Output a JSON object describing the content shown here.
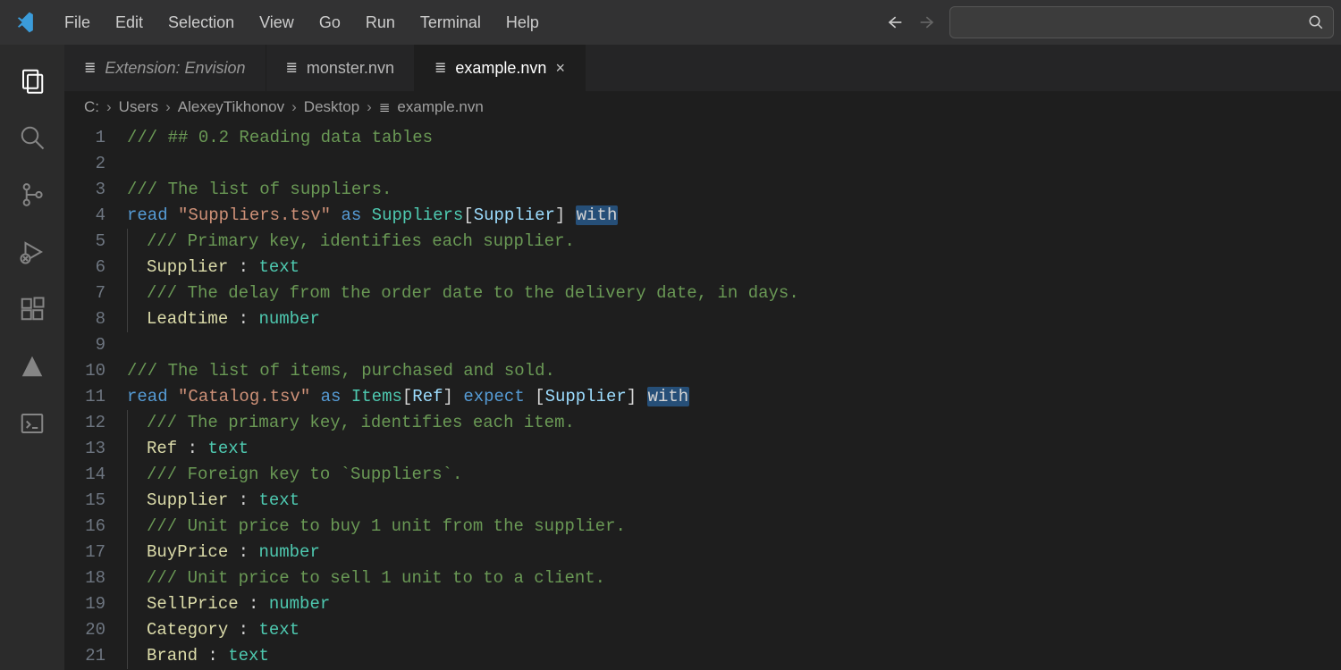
{
  "menubar": {
    "items": [
      "File",
      "Edit",
      "Selection",
      "View",
      "Go",
      "Run",
      "Terminal",
      "Help"
    ]
  },
  "tabs": [
    {
      "label": "Extension: Envision",
      "active": false,
      "italic": true,
      "closable": false
    },
    {
      "label": "monster.nvn",
      "active": false,
      "italic": false,
      "closable": false
    },
    {
      "label": "example.nvn",
      "active": true,
      "italic": false,
      "closable": true
    }
  ],
  "breadcrumbs": [
    "C:",
    "Users",
    "AlexeyTikhonov",
    "Desktop",
    "example.nvn"
  ],
  "code": {
    "lines": [
      {
        "n": 1,
        "indent": 0,
        "tokens": [
          [
            "comment",
            "/// ## 0.2 Reading data tables"
          ]
        ]
      },
      {
        "n": 2,
        "indent": 0,
        "tokens": []
      },
      {
        "n": 3,
        "indent": 0,
        "tokens": [
          [
            "comment",
            "/// The list of suppliers."
          ]
        ]
      },
      {
        "n": 4,
        "indent": 0,
        "tokens": [
          [
            "keyword",
            "read"
          ],
          [
            "punct",
            " "
          ],
          [
            "string",
            "\"Suppliers.tsv\""
          ],
          [
            "punct",
            " "
          ],
          [
            "keyword",
            "as"
          ],
          [
            "punct",
            " "
          ],
          [
            "type",
            "Suppliers"
          ],
          [
            "punct",
            "["
          ],
          [
            "ident-b",
            "Supplier"
          ],
          [
            "punct",
            "] "
          ],
          [
            "selected",
            "with"
          ]
        ]
      },
      {
        "n": 5,
        "indent": 1,
        "tokens": [
          [
            "comment",
            "/// Primary key, identifies each supplier."
          ]
        ]
      },
      {
        "n": 6,
        "indent": 1,
        "tokens": [
          [
            "ident",
            "Supplier"
          ],
          [
            "punct",
            " : "
          ],
          [
            "type",
            "text"
          ]
        ]
      },
      {
        "n": 7,
        "indent": 1,
        "tokens": [
          [
            "comment",
            "/// The delay from the order date to the delivery date, in days."
          ]
        ]
      },
      {
        "n": 8,
        "indent": 1,
        "tokens": [
          [
            "ident",
            "Leadtime"
          ],
          [
            "punct",
            " : "
          ],
          [
            "type",
            "number"
          ]
        ]
      },
      {
        "n": 9,
        "indent": 0,
        "tokens": []
      },
      {
        "n": 10,
        "indent": 0,
        "tokens": [
          [
            "comment",
            "/// The list of items, purchased and sold."
          ]
        ]
      },
      {
        "n": 11,
        "indent": 0,
        "tokens": [
          [
            "keyword",
            "read"
          ],
          [
            "punct",
            " "
          ],
          [
            "string",
            "\"Catalog.tsv\""
          ],
          [
            "punct",
            " "
          ],
          [
            "keyword",
            "as"
          ],
          [
            "punct",
            " "
          ],
          [
            "type",
            "Items"
          ],
          [
            "punct",
            "["
          ],
          [
            "ident-b",
            "Ref"
          ],
          [
            "punct",
            "] "
          ],
          [
            "keyword",
            "expect"
          ],
          [
            "punct",
            " ["
          ],
          [
            "ident-b",
            "Supplier"
          ],
          [
            "punct",
            "] "
          ],
          [
            "selected",
            "with"
          ]
        ]
      },
      {
        "n": 12,
        "indent": 1,
        "tokens": [
          [
            "comment",
            "/// The primary key, identifies each item."
          ]
        ]
      },
      {
        "n": 13,
        "indent": 1,
        "tokens": [
          [
            "ident",
            "Ref"
          ],
          [
            "punct",
            " : "
          ],
          [
            "type",
            "text"
          ]
        ]
      },
      {
        "n": 14,
        "indent": 1,
        "tokens": [
          [
            "comment",
            "/// Foreign key to `Suppliers`."
          ]
        ]
      },
      {
        "n": 15,
        "indent": 1,
        "tokens": [
          [
            "ident",
            "Supplier"
          ],
          [
            "punct",
            " : "
          ],
          [
            "type",
            "text"
          ]
        ]
      },
      {
        "n": 16,
        "indent": 1,
        "tokens": [
          [
            "comment",
            "/// Unit price to buy 1 unit from the supplier."
          ]
        ]
      },
      {
        "n": 17,
        "indent": 1,
        "tokens": [
          [
            "ident",
            "BuyPrice"
          ],
          [
            "punct",
            " : "
          ],
          [
            "type",
            "number"
          ]
        ]
      },
      {
        "n": 18,
        "indent": 1,
        "tokens": [
          [
            "comment",
            "/// Unit price to sell 1 unit to to a client."
          ]
        ]
      },
      {
        "n": 19,
        "indent": 1,
        "tokens": [
          [
            "ident",
            "SellPrice"
          ],
          [
            "punct",
            " : "
          ],
          [
            "type",
            "number"
          ]
        ]
      },
      {
        "n": 20,
        "indent": 1,
        "tokens": [
          [
            "ident",
            "Category"
          ],
          [
            "punct",
            " : "
          ],
          [
            "type",
            "text"
          ]
        ]
      },
      {
        "n": 21,
        "indent": 1,
        "tokens": [
          [
            "ident",
            "Brand"
          ],
          [
            "punct",
            " : "
          ],
          [
            "type",
            "text"
          ]
        ]
      }
    ]
  },
  "activity_icons": [
    "explorer",
    "search",
    "source-control",
    "run-debug",
    "extensions",
    "azure",
    "terminal"
  ]
}
